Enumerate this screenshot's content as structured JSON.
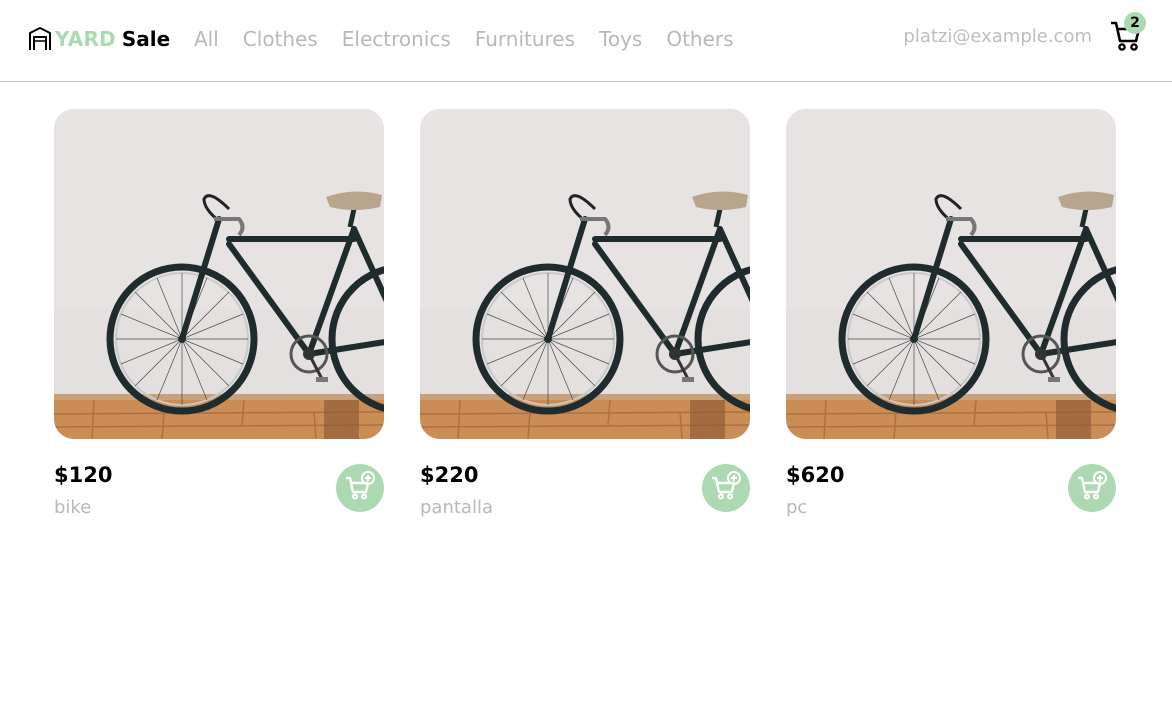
{
  "navbar": {
    "brand": {
      "yard": "YARD",
      "sale": "Sale",
      "icon": "garage-icon"
    },
    "links": [
      "All",
      "Clothes",
      "Electronics",
      "Furnitures",
      "Toys",
      "Others"
    ],
    "email": "platzi@example.com",
    "cart": {
      "count": "2",
      "icon": "shopping-cart-icon"
    }
  },
  "products": [
    {
      "price": "$120",
      "name": "bike",
      "image": "bicycle-photo"
    },
    {
      "price": "$220",
      "name": "pantalla",
      "image": "bicycle-photo"
    },
    {
      "price": "$620",
      "name": "pc",
      "image": "bicycle-photo"
    }
  ],
  "colors": {
    "accent": "#acd9b2",
    "muted_text": "#b8b8b8",
    "border": "#c9c9c9"
  }
}
